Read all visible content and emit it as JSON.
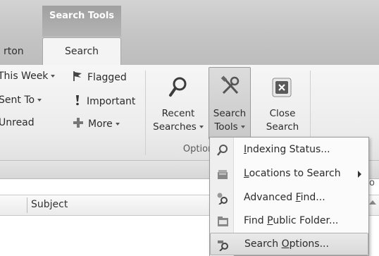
{
  "contextual_tab_group": "Search Tools",
  "tabs": {
    "partial_left": "rton",
    "active": "Search"
  },
  "filters": {
    "this_week": "This Week",
    "sent_to": "Sent To",
    "unread": "Unread",
    "flagged": "Flagged",
    "important": "Important",
    "more": "More"
  },
  "options_group": {
    "recent_searches": [
      "Recent",
      "Searches"
    ],
    "search_tools": [
      "Search",
      "Tools"
    ],
    "close_search": [
      "Close",
      "Search"
    ],
    "label": "Options"
  },
  "column_header": {
    "subject": "Subject"
  },
  "menu": {
    "items": [
      {
        "label_pre": "",
        "accel": "I",
        "label_post": "ndexing Status...",
        "icon": "indexing-status-icon",
        "submenu": false,
        "highlighted": false
      },
      {
        "label_pre": "",
        "accel": "L",
        "label_post": "ocations to Search",
        "icon": "locations-to-search-icon",
        "submenu": true,
        "highlighted": false
      },
      {
        "label_pre": "Advanced ",
        "accel": "F",
        "label_post": "ind...",
        "icon": "advanced-find-icon",
        "submenu": false,
        "highlighted": false
      },
      {
        "label_pre": "Find ",
        "accel": "P",
        "label_post": "ublic Folder...",
        "icon": "find-public-folder-icon",
        "submenu": false,
        "highlighted": false
      },
      {
        "label_pre": "Search ",
        "accel": "O",
        "label_post": "ptions...",
        "icon": "search-options-icon",
        "submenu": false,
        "highlighted": true
      }
    ]
  },
  "colors": {
    "menu_highlight": "#d9d9d9",
    "contextual_group": "#a8a8a8",
    "close_icon": "#5a5a5a"
  }
}
